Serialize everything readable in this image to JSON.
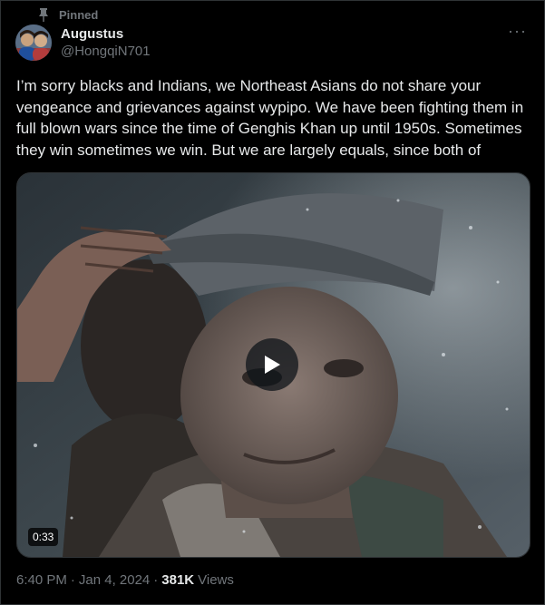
{
  "pinned": {
    "label": "Pinned",
    "icon": "pin-icon"
  },
  "author": {
    "display_name": "Augustus",
    "handle": "@HongqiN701",
    "avatar": "avatar"
  },
  "more": {
    "icon": "more-icon",
    "label": "···"
  },
  "tweet": {
    "text": "I’m sorry blacks and Indians, we Northeast Asians do not share your vengeance and grievances against wypipo. We have been fighting them in full blown wars since the time of Genghis Khan up until 1950s. Sometimes they win sometimes we win. But we are largely equals, since both of"
  },
  "media": {
    "type": "video",
    "duration": "0:33",
    "play_icon": "play-icon"
  },
  "meta": {
    "time": "6:40 PM",
    "separator": "·",
    "date": "Jan 4, 2024",
    "views_count": "381K",
    "views_label": "Views"
  },
  "colors": {
    "background": "#000000",
    "text": "#e7e9ea",
    "secondary": "#71767b",
    "border": "#2f3336"
  }
}
